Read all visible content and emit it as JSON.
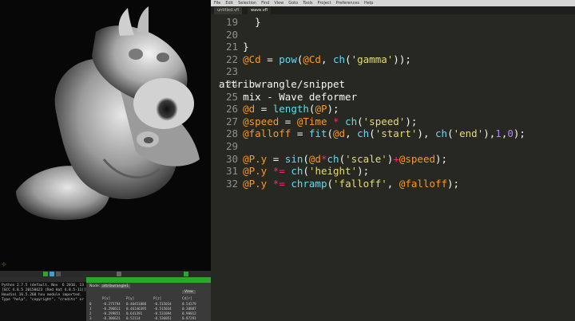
{
  "menu": {
    "items": [
      "File",
      "Edit",
      "Selection",
      "Find",
      "View",
      "Goto",
      "Tools",
      "Project",
      "Preferences",
      "Help"
    ]
  },
  "tabs": [
    "untitled.vfl",
    "wave.vfl"
  ],
  "code": {
    "lines": [
      {
        "n": "19",
        "parts": [
          {
            "c": "",
            "t": "      }"
          }
        ]
      },
      {
        "n": "20",
        "parts": [
          {
            "c": "",
            "t": ""
          }
        ]
      },
      {
        "n": "21",
        "parts": [
          {
            "c": "",
            "t": "    }"
          }
        ]
      },
      {
        "n": "22",
        "parts": [
          {
            "c": "",
            "t": "    "
          },
          {
            "c": "at",
            "t": "@Cd"
          },
          {
            "c": "",
            "t": " = "
          },
          {
            "c": "fn",
            "t": "pow"
          },
          {
            "c": "",
            "t": "("
          },
          {
            "c": "at",
            "t": "@Cd"
          },
          {
            "c": "",
            "t": ", "
          },
          {
            "c": "fn",
            "t": "ch"
          },
          {
            "c": "",
            "t": "("
          },
          {
            "c": "str",
            "t": "'gamma'"
          },
          {
            "c": "",
            "t": "));"
          }
        ]
      },
      {
        "n": "23",
        "parts": [
          {
            "c": "",
            "t": ""
          }
        ]
      },
      {
        "n": "24",
        "parts": [
          {
            "c": "",
            "t": "attribwrangle/snippet"
          }
        ]
      },
      {
        "n": "25",
        "parts": [
          {
            "c": "",
            "t": "    mix - Wave deformer"
          }
        ]
      },
      {
        "n": "26",
        "parts": [
          {
            "c": "",
            "t": "    "
          },
          {
            "c": "at",
            "t": "@d"
          },
          {
            "c": "",
            "t": " = "
          },
          {
            "c": "fn",
            "t": "length"
          },
          {
            "c": "",
            "t": "("
          },
          {
            "c": "at",
            "t": "@P"
          },
          {
            "c": "",
            "t": ");"
          }
        ]
      },
      {
        "n": "27",
        "parts": [
          {
            "c": "",
            "t": "    "
          },
          {
            "c": "at",
            "t": "@speed"
          },
          {
            "c": "",
            "t": " = "
          },
          {
            "c": "at",
            "t": "@Time"
          },
          {
            "c": "kw",
            "t": " * "
          },
          {
            "c": "fn",
            "t": "ch"
          },
          {
            "c": "",
            "t": "("
          },
          {
            "c": "str",
            "t": "'speed'"
          },
          {
            "c": "",
            "t": ");"
          }
        ]
      },
      {
        "n": "28",
        "parts": [
          {
            "c": "",
            "t": "    "
          },
          {
            "c": "at",
            "t": "@falloff"
          },
          {
            "c": "",
            "t": " = "
          },
          {
            "c": "fn",
            "t": "fit"
          },
          {
            "c": "",
            "t": "("
          },
          {
            "c": "at",
            "t": "@d"
          },
          {
            "c": "",
            "t": ", "
          },
          {
            "c": "fn",
            "t": "ch"
          },
          {
            "c": "",
            "t": "("
          },
          {
            "c": "str",
            "t": "'start'"
          },
          {
            "c": "",
            "t": "), "
          },
          {
            "c": "fn",
            "t": "ch"
          },
          {
            "c": "",
            "t": "("
          },
          {
            "c": "str",
            "t": "'end'"
          },
          {
            "c": "",
            "t": "),"
          },
          {
            "c": "num",
            "t": "1"
          },
          {
            "c": "",
            "t": ","
          },
          {
            "c": "num",
            "t": "0"
          },
          {
            "c": "",
            "t": ");"
          }
        ]
      },
      {
        "n": "29",
        "parts": [
          {
            "c": "",
            "t": ""
          }
        ]
      },
      {
        "n": "30",
        "parts": [
          {
            "c": "",
            "t": "    "
          },
          {
            "c": "at",
            "t": "@P.y"
          },
          {
            "c": "",
            "t": " = "
          },
          {
            "c": "fn",
            "t": "sin"
          },
          {
            "c": "",
            "t": "("
          },
          {
            "c": "at",
            "t": "@d"
          },
          {
            "c": "kw",
            "t": "*"
          },
          {
            "c": "fn",
            "t": "ch"
          },
          {
            "c": "",
            "t": "("
          },
          {
            "c": "str",
            "t": "'scale'"
          },
          {
            "c": "",
            "t": ")"
          },
          {
            "c": "kw",
            "t": "+"
          },
          {
            "c": "at",
            "t": "@speed"
          },
          {
            "c": "",
            "t": ");"
          }
        ]
      },
      {
        "n": "31",
        "parts": [
          {
            "c": "",
            "t": "    "
          },
          {
            "c": "at",
            "t": "@P.y"
          },
          {
            "c": "kw",
            "t": " *= "
          },
          {
            "c": "fn",
            "t": "ch"
          },
          {
            "c": "",
            "t": "("
          },
          {
            "c": "str",
            "t": "'height'"
          },
          {
            "c": "",
            "t": ");"
          }
        ]
      },
      {
        "n": "32",
        "parts": [
          {
            "c": "",
            "t": "    "
          },
          {
            "c": "at",
            "t": "@P.y"
          },
          {
            "c": "kw",
            "t": " *= "
          },
          {
            "c": "fn",
            "t": "chramp"
          },
          {
            "c": "",
            "t": "("
          },
          {
            "c": "str",
            "t": "'falloff'"
          },
          {
            "c": "",
            "t": ", "
          },
          {
            "c": "at",
            "t": "@falloff"
          },
          {
            "c": "",
            "t": ");"
          }
        ]
      }
    ]
  },
  "console": {
    "lines": [
      "Python 2.7.5 (default, Nov  6 2016, 13",
      "[GCC 4.8.5 20150623 (Red Hat 4.8.5-11)]",
      "Houdini 16.5.268 hou module imported.",
      "Type \"help\", \"copyright\", \"credits\" or"
    ]
  },
  "sheet": {
    "node_label": "Node:",
    "node_value": "attribwrangle1",
    "view_label": "View",
    "columns": [
      "",
      "P[x]",
      "P[y]",
      "P[z]",
      "Cd[r]"
    ],
    "rows": [
      [
        "0",
        "-0.275794",
        "0.46451086",
        "-0.515034",
        "0.54279"
      ],
      [
        "1",
        "-0.296611",
        "0.46146395",
        "-0.515034",
        "0.30887"
      ],
      [
        "2",
        "-0.299851",
        "0.641391",
        "-0.531094",
        "0.98012"
      ],
      [
        "3",
        "-0.306621",
        "0.52114",
        "-0.536051",
        "0.87291"
      ]
    ]
  },
  "colors": {
    "editor_bg": "#272822",
    "at_var": "#fd971f",
    "keyword": "#f92672",
    "string": "#e6db74",
    "function": "#66d9ef",
    "number": "#ae81ff",
    "accent_green": "#2ca52c"
  }
}
